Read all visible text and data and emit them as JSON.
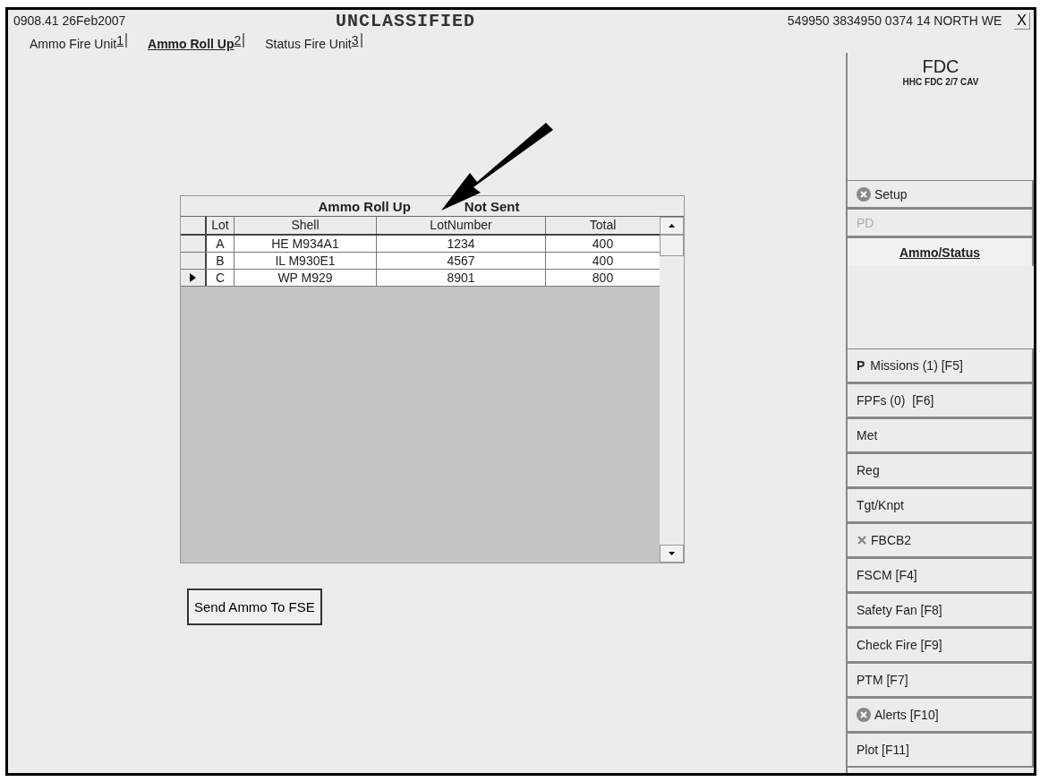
{
  "header": {
    "time": "0908.41 26Feb2007",
    "classification": "UNCLASSIFIED",
    "position": "549950 3834950 0374 14 NORTH WE",
    "close": "X"
  },
  "tabs": [
    {
      "label": "Ammo Fire Unit",
      "key": "1",
      "selected": false
    },
    {
      "label": "Ammo Roll Up",
      "key": "2",
      "selected": true
    },
    {
      "label": "Status Fire Unit",
      "key": "3",
      "selected": false
    }
  ],
  "table": {
    "title": "Ammo Roll Up",
    "status": "Not Sent",
    "columns": [
      "Lot",
      "Shell",
      "LotNumber",
      "Total"
    ],
    "rows": [
      {
        "cells": [
          "A",
          "HE M934A1",
          "1234",
          "400"
        ],
        "selected": false
      },
      {
        "cells": [
          "B",
          "IL M930E1",
          "4567",
          "400"
        ],
        "selected": false
      },
      {
        "cells": [
          "C",
          "WP M929",
          "8901",
          "800"
        ],
        "selected": true
      }
    ]
  },
  "send_button": "Send Ammo To FSE",
  "sidebar": {
    "title": "FDC",
    "unit": "HHC FDC 2/7 CAV",
    "top_items": [
      {
        "label": "Setup",
        "kind": "error",
        "selected": false,
        "disabled": false
      },
      {
        "label": "PD",
        "selected": false,
        "disabled": true
      },
      {
        "label": "Ammo/Status",
        "selected": true,
        "disabled": false
      }
    ],
    "bottom_items": [
      {
        "label": "Missions (1) [F5]",
        "prefix": "P",
        "selected": false,
        "disabled": false
      },
      {
        "label": "FPFs (0)  [F6]",
        "selected": false,
        "disabled": false
      },
      {
        "label": "Met",
        "selected": false,
        "disabled": false
      },
      {
        "label": "Reg",
        "selected": false,
        "disabled": false
      },
      {
        "label": "Tgt/Knpt",
        "selected": false,
        "disabled": false
      },
      {
        "label": "FBCB2",
        "kind": "cross",
        "selected": false,
        "disabled": false
      },
      {
        "label": "FSCM [F4]",
        "selected": false,
        "disabled": false
      },
      {
        "label": "Safety Fan [F8]",
        "selected": false,
        "disabled": false
      },
      {
        "label": "Check Fire [F9]",
        "selected": false,
        "disabled": false
      },
      {
        "label": "PTM [F7]",
        "selected": false,
        "disabled": false
      },
      {
        "label": "Alerts [F10]",
        "kind": "error",
        "selected": false,
        "disabled": false
      },
      {
        "label": "Plot [F11]",
        "selected": false,
        "disabled": false
      }
    ]
  }
}
